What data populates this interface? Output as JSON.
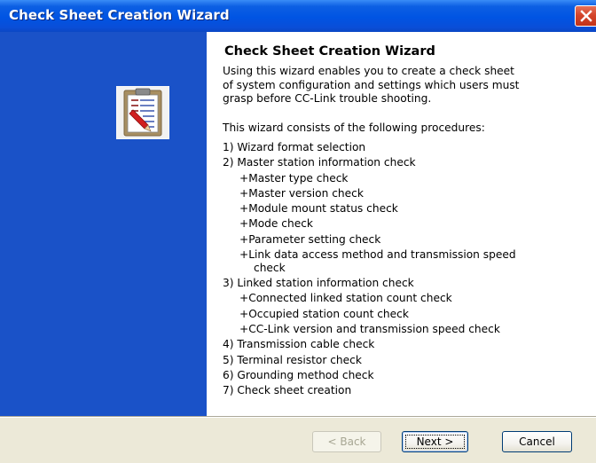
{
  "window": {
    "title": "Check Sheet Creation Wizard"
  },
  "icons": {
    "close": "close-x-icon",
    "wizard": "clipboard-checklist-icon"
  },
  "colors": {
    "titlebar": "#0054e3",
    "left_panel": "#1a52c8",
    "content_bg": "#ffffff",
    "footer_bg": "#ece9d8",
    "close_button": "#d4452b"
  },
  "content": {
    "heading": "Check Sheet Creation Wizard",
    "intro_lines": [
      "Using this wizard enables you to create a check sheet",
      "of system configuration and settings which users must",
      "grasp before CC-Link trouble shooting."
    ],
    "consists": "This wizard consists of the following procedures:",
    "procedures": [
      "1) Wizard format selection",
      "2) Master station information check",
      "+Master type check",
      "+Master version check",
      "+Module mount status check",
      "+Mode check",
      "+Parameter setting check",
      "+Link data access method and transmission speed",
      "check",
      "3) Linked station information check",
      "+Connected linked station count check",
      "+Occupied station count check",
      "+CC-Link version and transmission speed check",
      "4) Transmission cable check",
      "5) Terminal resistor check",
      "6) Grounding method check",
      "7) Check sheet creation"
    ]
  },
  "buttons": {
    "back": "< Back",
    "next": "Next >",
    "cancel": "Cancel"
  }
}
